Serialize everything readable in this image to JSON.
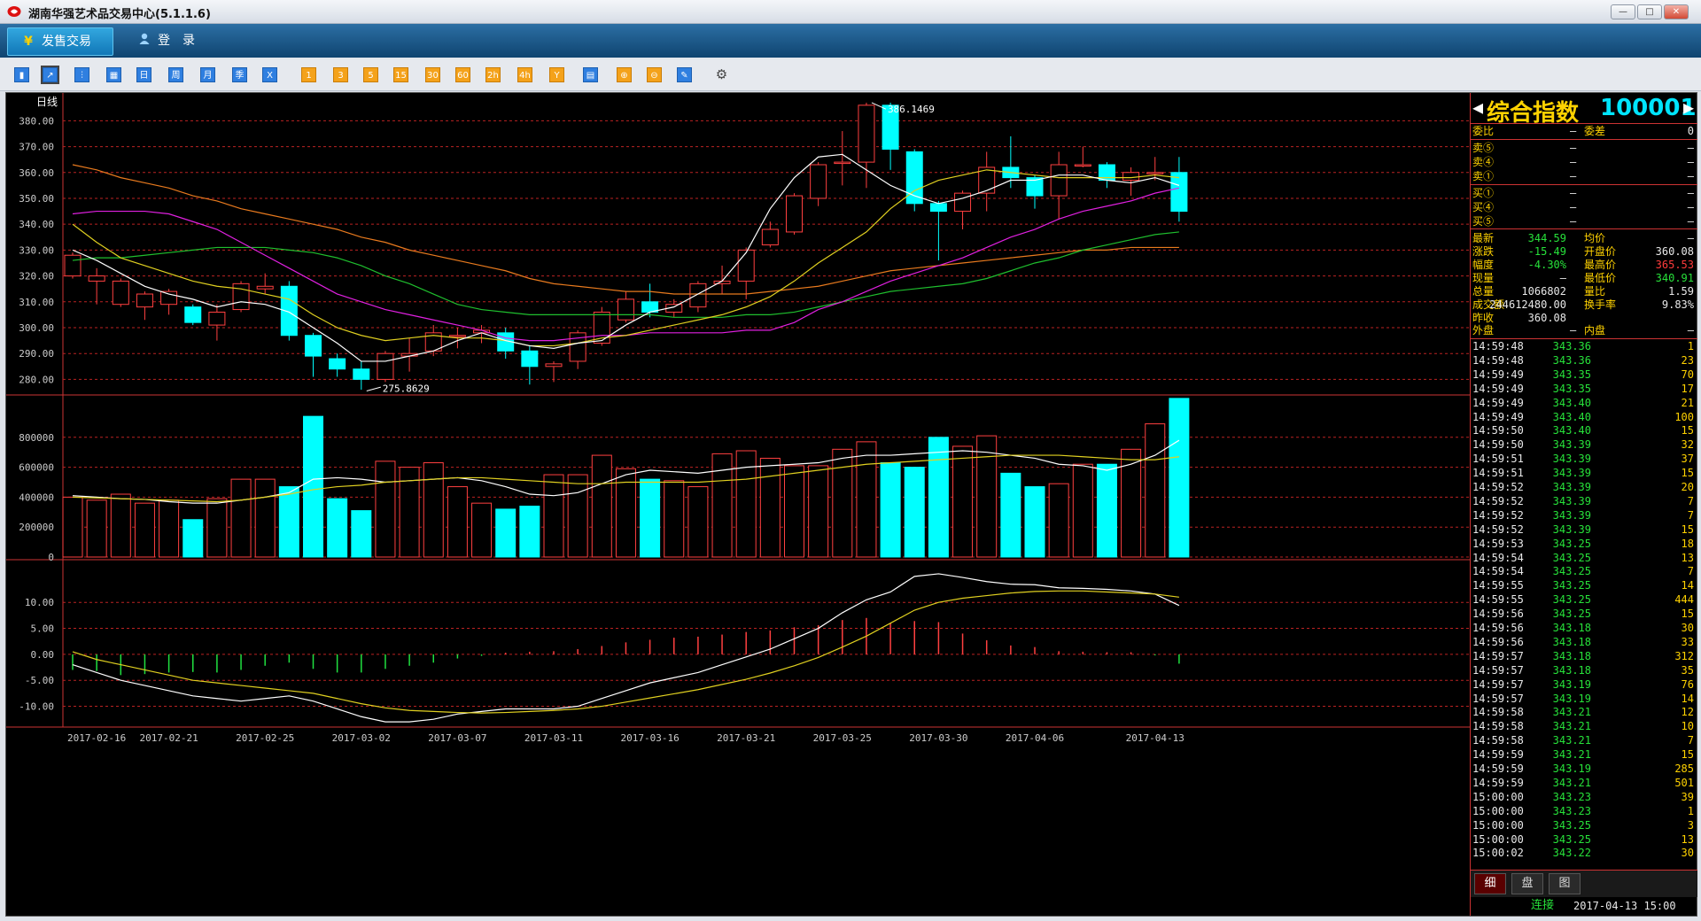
{
  "app": {
    "title": "湖南华强艺术品交易中心(5.1.1.6)"
  },
  "window_controls": {
    "minimize": "—",
    "maximize": "□",
    "close": "✕"
  },
  "menu": {
    "sell_label": "发售交易",
    "login_label": "登　录",
    "sell_icon": "¥"
  },
  "toolbar": {
    "items": [
      {
        "label": "▮",
        "style": "blue"
      },
      {
        "label": "↗",
        "style": "blue"
      },
      {
        "label": "⫶",
        "style": "blue"
      },
      {
        "label": "▦",
        "style": "blue"
      },
      {
        "label": "日",
        "style": "blue"
      },
      {
        "label": "周",
        "style": "blue"
      },
      {
        "label": "月",
        "style": "blue"
      },
      {
        "label": "季",
        "style": "blue"
      },
      {
        "label": "X",
        "style": "blue"
      },
      {
        "label": "1",
        "style": "org"
      },
      {
        "label": "3",
        "style": "org"
      },
      {
        "label": "5",
        "style": "org"
      },
      {
        "label": "15",
        "style": "org"
      },
      {
        "label": "30",
        "style": "org"
      },
      {
        "label": "60",
        "style": "org"
      },
      {
        "label": "2h",
        "style": "org"
      },
      {
        "label": "4h",
        "style": "org"
      },
      {
        "label": "Y",
        "style": "org"
      },
      {
        "label": "▤",
        "style": "blue"
      },
      {
        "label": "⊕",
        "style": "org"
      },
      {
        "label": "⊖",
        "style": "org"
      },
      {
        "label": "✎",
        "style": "blue"
      },
      {
        "label": "⚙",
        "style": "plain"
      }
    ]
  },
  "chart_data": {
    "type": "candlestick",
    "period_label": "日线",
    "dates": [
      "2017-02-16",
      "2017-02-21",
      "2017-02-25",
      "2017-03-02",
      "2017-03-07",
      "2017-03-11",
      "2017-03-16",
      "2017-03-21",
      "2017-03-25",
      "2017-03-30",
      "2017-04-06",
      "2017-04-13"
    ],
    "price_axis": {
      "ticks": [
        "380.00",
        "370.00",
        "360.00",
        "350.00",
        "340.00",
        "330.00",
        "320.00",
        "310.00",
        "300.00",
        "290.00",
        "280.00"
      ],
      "min": 275,
      "max": 388
    },
    "annotations": {
      "high": "386.1469",
      "low": "275.8629"
    },
    "candles": [
      [
        320,
        328,
        319,
        329
      ],
      [
        318,
        320,
        309,
        323
      ],
      [
        309,
        318,
        308,
        319
      ],
      [
        308,
        313,
        303,
        314
      ],
      [
        309,
        314,
        305,
        315
      ],
      [
        308,
        302,
        301,
        309
      ],
      [
        301,
        306,
        295,
        309
      ],
      [
        307,
        317,
        306,
        318
      ],
      [
        315,
        316,
        313,
        321
      ],
      [
        316,
        297,
        295,
        318
      ],
      [
        297,
        289,
        281,
        298
      ],
      [
        288,
        284,
        281,
        290
      ],
      [
        284,
        280,
        276,
        287
      ],
      [
        280,
        290,
        279,
        291
      ],
      [
        289,
        290,
        283,
        296
      ],
      [
        291,
        298,
        289,
        301
      ],
      [
        297,
        297,
        292,
        300
      ],
      [
        298,
        299,
        294,
        301
      ],
      [
        298,
        291,
        288,
        300
      ],
      [
        291,
        285,
        278,
        293
      ],
      [
        285,
        286,
        279,
        287
      ],
      [
        287,
        298,
        284,
        299
      ],
      [
        294,
        306,
        293,
        308
      ],
      [
        303,
        311,
        302,
        314
      ],
      [
        310,
        306,
        304,
        317
      ],
      [
        306,
        309,
        304,
        311
      ],
      [
        308,
        317,
        306,
        318
      ],
      [
        317,
        318,
        313,
        324
      ],
      [
        318,
        330,
        311,
        331
      ],
      [
        332,
        338,
        331,
        341
      ],
      [
        337,
        351,
        336,
        352
      ],
      [
        350,
        363,
        347,
        364
      ],
      [
        364,
        364,
        355,
        376
      ],
      [
        364,
        386,
        354,
        387
      ],
      [
        386,
        369,
        361,
        387
      ],
      [
        368,
        348,
        345,
        369
      ],
      [
        348,
        345,
        326,
        349
      ],
      [
        345,
        352,
        338,
        353
      ],
      [
        352,
        362,
        345,
        368
      ],
      [
        362,
        358,
        354,
        374
      ],
      [
        358,
        351,
        346,
        359
      ],
      [
        351,
        363,
        342,
        368
      ],
      [
        363,
        363,
        362,
        370
      ],
      [
        363,
        357,
        354,
        364
      ],
      [
        357,
        360,
        351,
        362
      ],
      [
        360,
        360,
        357,
        366
      ],
      [
        360,
        345,
        341,
        366
      ]
    ],
    "ma5": [
      330,
      326,
      321,
      316,
      313,
      311,
      308,
      310,
      309,
      306,
      300,
      294,
      287,
      287,
      289,
      291,
      295,
      298,
      295,
      293,
      292,
      294,
      295,
      301,
      306,
      308,
      313,
      318,
      329,
      346,
      358,
      366,
      367,
      361,
      355,
      351,
      348,
      350,
      353,
      357,
      357,
      359,
      359,
      357,
      356,
      358,
      355
    ],
    "ma10": [
      340,
      333,
      327,
      324,
      321,
      318,
      316,
      315,
      313,
      311,
      305,
      300,
      297,
      295,
      296,
      297,
      296,
      296,
      295,
      293,
      293,
      294,
      296,
      297,
      299,
      301,
      303,
      305,
      308,
      312,
      318,
      325,
      331,
      337,
      346,
      353,
      357,
      359,
      361,
      360,
      359,
      358,
      358,
      358,
      358,
      359,
      358
    ],
    "ma20": [
      344,
      345,
      345,
      345,
      344,
      341,
      338,
      333,
      328,
      323,
      318,
      313,
      310,
      307,
      305,
      303,
      301,
      299,
      296,
      295,
      295,
      296,
      297,
      297,
      298,
      298,
      298,
      298,
      299,
      299,
      302,
      307,
      310,
      314,
      318,
      321,
      324,
      327,
      331,
      335,
      338,
      342,
      345,
      347,
      349,
      352,
      354
    ],
    "ma30": [
      326,
      327,
      327,
      328,
      329,
      330,
      331,
      331,
      331,
      330,
      329,
      327,
      324,
      320,
      317,
      313,
      309,
      307,
      306,
      305,
      305,
      305,
      305,
      305,
      305,
      304,
      304,
      304,
      305,
      305,
      306,
      308,
      310,
      312,
      314,
      315,
      316,
      317,
      319,
      322,
      325,
      327,
      330,
      332,
      334,
      336,
      337
    ],
    "ma60": [
      363,
      361,
      358,
      356,
      354,
      351,
      349,
      346,
      344,
      342,
      340,
      338,
      335,
      333,
      330,
      328,
      326,
      324,
      322,
      319,
      317,
      316,
      315,
      314,
      314,
      313,
      313,
      313,
      313,
      314,
      315,
      316,
      318,
      320,
      322,
      323,
      324,
      325,
      326,
      327,
      328,
      329,
      330,
      330,
      331,
      331,
      331
    ],
    "volume_axis": {
      "ticks": [
        "800000",
        "600000",
        "400000",
        "200000",
        "0"
      ],
      "max": 1000000
    },
    "volumes": [
      400000,
      380000,
      420000,
      360000,
      380000,
      250000,
      390000,
      520000,
      520000,
      470000,
      940000,
      390000,
      310000,
      640000,
      600000,
      630000,
      470000,
      360000,
      320000,
      340000,
      550000,
      550000,
      680000,
      590000,
      520000,
      510000,
      470000,
      690000,
      710000,
      660000,
      610000,
      610000,
      720000,
      770000,
      630000,
      600000,
      800000,
      740000,
      810000,
      560000,
      470000,
      490000,
      620000,
      620000,
      720000,
      890000,
      1060000
    ],
    "vol_ma5": [
      410000,
      400000,
      390000,
      385000,
      370000,
      360000,
      360000,
      380000,
      400000,
      430000,
      520000,
      530000,
      520000,
      500000,
      510000,
      520000,
      530000,
      510000,
      470000,
      420000,
      410000,
      430000,
      490000,
      550000,
      580000,
      570000,
      560000,
      580000,
      600000,
      610000,
      620000,
      630000,
      660000,
      680000,
      680000,
      690000,
      700000,
      710000,
      700000,
      680000,
      660000,
      620000,
      610000,
      580000,
      620000,
      680000,
      780000
    ],
    "vol_ma10": [
      400000,
      395000,
      390000,
      385000,
      380000,
      375000,
      370000,
      380000,
      400000,
      420000,
      450000,
      470000,
      480000,
      500000,
      510000,
      520000,
      530000,
      530000,
      520000,
      510000,
      500000,
      490000,
      490000,
      500000,
      500000,
      500000,
      500000,
      510000,
      520000,
      540000,
      560000,
      580000,
      600000,
      620000,
      630000,
      640000,
      650000,
      660000,
      670000,
      680000,
      680000,
      680000,
      670000,
      660000,
      650000,
      650000,
      670000
    ],
    "macd_axis": {
      "ticks": [
        "10.00",
        "5.00",
        "0.00",
        "-5.00",
        "-10.00"
      ],
      "min": -14,
      "max": 16
    },
    "dif": [
      -2,
      -3.5,
      -5,
      -6,
      -7,
      -8,
      -8.5,
      -9,
      -8.5,
      -8,
      -9,
      -10.5,
      -12,
      -13,
      -13,
      -12.5,
      -11.5,
      -11,
      -10.5,
      -10.5,
      -10.5,
      -10,
      -8.5,
      -7,
      -5.5,
      -4.5,
      -3.5,
      -2,
      -0.5,
      1,
      3,
      5,
      8,
      10.5,
      12,
      15,
      15.5,
      14.8,
      14,
      13.5,
      13.4,
      12.8,
      12.7,
      12.5,
      12.2,
      11.6,
      9.4
    ],
    "dea": [
      0.5,
      -1,
      -2,
      -3,
      -4,
      -5,
      -5.5,
      -6,
      -6.5,
      -7,
      -7.5,
      -8.5,
      -9.5,
      -10.3,
      -10.8,
      -11,
      -11.2,
      -11.3,
      -11.2,
      -11,
      -10.8,
      -10.5,
      -10,
      -9.2,
      -8.4,
      -7.6,
      -6.8,
      -5.8,
      -4.8,
      -3.6,
      -2.2,
      -0.6,
      1.4,
      3.5,
      6,
      8.5,
      10,
      10.8,
      11.3,
      11.8,
      12.1,
      12.2,
      12.2,
      12,
      11.8,
      11.6,
      11
    ],
    "histogram": [
      -3,
      -3.2,
      -4,
      -3.8,
      -3.5,
      -3.4,
      -3.5,
      -3,
      -2.2,
      -1.6,
      -2.8,
      -3.5,
      -3.5,
      -2.8,
      -2.2,
      -1.6,
      -0.8,
      -0.3,
      0.3,
      0.5,
      0.6,
      1,
      1.6,
      2.3,
      2.8,
      3.2,
      3.4,
      3.8,
      4.3,
      4.6,
      5.2,
      5.6,
      6.6,
      7,
      6,
      6.4,
      6.2,
      4,
      2.7,
      1.7,
      1.4,
      0.6,
      0.5,
      0.4,
      0.4,
      -0.2,
      -1.8
    ]
  },
  "panel": {
    "name": "综合指数",
    "code": "100001",
    "order_ratio_label": "委比",
    "order_ratio_value": "—",
    "order_diff_label": "委差",
    "order_diff_value": "0",
    "sells": [
      {
        "label": "卖⑤",
        "price": "—",
        "vol": "—"
      },
      {
        "label": "卖④",
        "price": "—",
        "vol": "—"
      },
      {
        "label": "卖①",
        "price": "—",
        "vol": "—"
      }
    ],
    "buys": [
      {
        "label": "买①",
        "price": "—",
        "vol": "—"
      },
      {
        "label": "买④",
        "price": "—",
        "vol": "—"
      },
      {
        "label": "买⑤",
        "price": "—",
        "vol": "—"
      }
    ],
    "stats": [
      {
        "l1": "最新",
        "v1": "344.59",
        "c1": "grn",
        "l2": "均价",
        "v2": "—",
        "c2": "wht"
      },
      {
        "l1": "涨跌",
        "v1": "-15.49",
        "c1": "grn",
        "l2": "开盘价",
        "v2": "360.08",
        "c2": "wht"
      },
      {
        "l1": "幅度",
        "v1": "-4.30%",
        "c1": "grn",
        "l2": "最高价",
        "v2": "365.53",
        "c2": "red"
      },
      {
        "l1": "现量",
        "v1": "—",
        "c1": "wht",
        "l2": "最低价",
        "v2": "340.91",
        "c2": "grn"
      },
      {
        "l1": "总量",
        "v1": "1066802",
        "c1": "wht",
        "l2": "量比",
        "v2": "1.59",
        "c2": "wht"
      },
      {
        "l1": "成交额",
        "v1": "244612480.00",
        "c1": "wht",
        "l2": "换手率",
        "v2": "9.83%",
        "c2": "wht"
      },
      {
        "l1": "昨收",
        "v1": "360.08",
        "c1": "wht",
        "l2": "",
        "v2": "",
        "c2": "wht"
      }
    ],
    "outer_label": "外盘",
    "outer_value": "—",
    "inner_label": "内盘",
    "inner_value": "—",
    "ticks": [
      [
        "14:59:48",
        "343.36",
        "1"
      ],
      [
        "14:59:48",
        "343.36",
        "23"
      ],
      [
        "14:59:49",
        "343.35",
        "70"
      ],
      [
        "14:59:49",
        "343.35",
        "17"
      ],
      [
        "14:59:49",
        "343.40",
        "21"
      ],
      [
        "14:59:49",
        "343.40",
        "100"
      ],
      [
        "14:59:50",
        "343.40",
        "15"
      ],
      [
        "14:59:50",
        "343.39",
        "32"
      ],
      [
        "14:59:51",
        "343.39",
        "37"
      ],
      [
        "14:59:51",
        "343.39",
        "15"
      ],
      [
        "14:59:52",
        "343.39",
        "20"
      ],
      [
        "14:59:52",
        "343.39",
        "7"
      ],
      [
        "14:59:52",
        "343.39",
        "7"
      ],
      [
        "14:59:52",
        "343.39",
        "15"
      ],
      [
        "14:59:53",
        "343.25",
        "18"
      ],
      [
        "14:59:54",
        "343.25",
        "13"
      ],
      [
        "14:59:54",
        "343.25",
        "7"
      ],
      [
        "14:59:55",
        "343.25",
        "14"
      ],
      [
        "14:59:55",
        "343.25",
        "444"
      ],
      [
        "14:59:56",
        "343.25",
        "15"
      ],
      [
        "14:59:56",
        "343.18",
        "30"
      ],
      [
        "14:59:56",
        "343.18",
        "33"
      ],
      [
        "14:59:57",
        "343.18",
        "312"
      ],
      [
        "14:59:57",
        "343.18",
        "35"
      ],
      [
        "14:59:57",
        "343.19",
        "76"
      ],
      [
        "14:59:57",
        "343.19",
        "14"
      ],
      [
        "14:59:58",
        "343.21",
        "12"
      ],
      [
        "14:59:58",
        "343.21",
        "10"
      ],
      [
        "14:59:58",
        "343.21",
        "7"
      ],
      [
        "14:59:59",
        "343.21",
        "15"
      ],
      [
        "14:59:59",
        "343.19",
        "285"
      ],
      [
        "14:59:59",
        "343.21",
        "501"
      ],
      [
        "15:00:00",
        "343.23",
        "39"
      ],
      [
        "15:00:00",
        "343.23",
        "1"
      ],
      [
        "15:00:00",
        "343.25",
        "3"
      ],
      [
        "15:00:00",
        "343.25",
        "13"
      ],
      [
        "15:00:02",
        "343.22",
        "30"
      ]
    ],
    "tabs": [
      "细",
      "盘",
      "图"
    ],
    "status_conn": "连接",
    "status_time": "2017-04-13 15:00"
  }
}
